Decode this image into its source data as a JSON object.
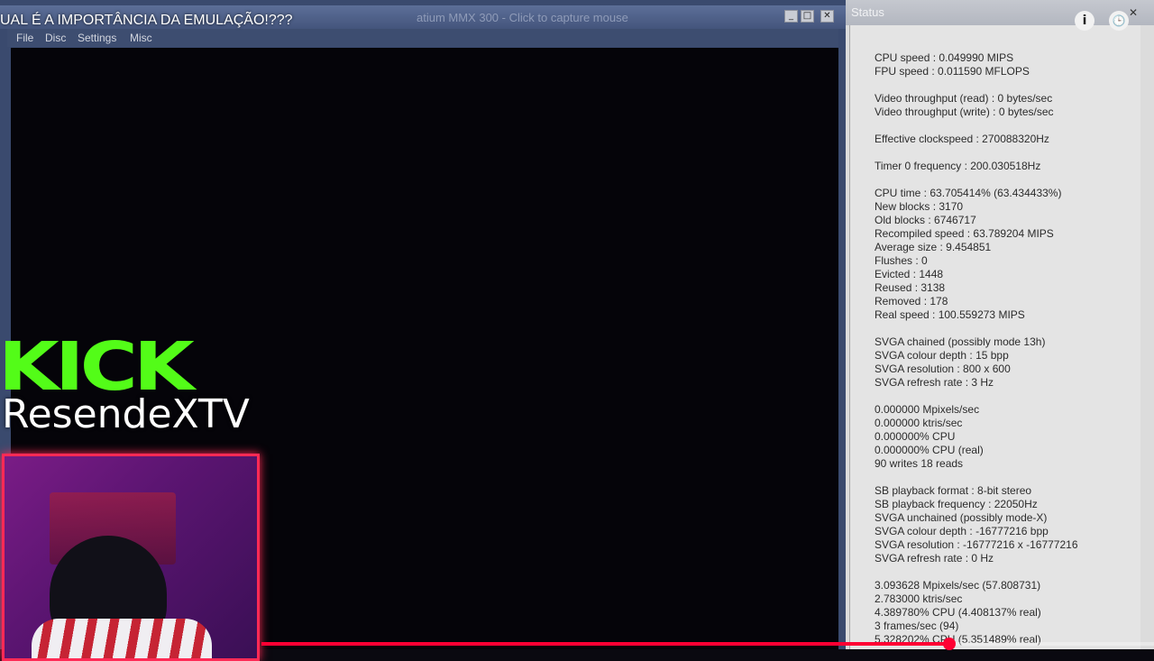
{
  "video": {
    "title": "UAL É A IMPORTÂNCIA DA EMULAÇÃO!???",
    "info_icon": "i",
    "clock_icon": "🕒",
    "progress": 0.771
  },
  "emulator": {
    "title": "atium MMX 300 - Click to capture mouse",
    "minimize": "_",
    "maximize": "□",
    "close": "✕",
    "menu": [
      "File",
      "Disc",
      "Settings",
      "Misc"
    ]
  },
  "status": {
    "title": "Status",
    "close": "✕",
    "lines": [
      "CPU speed : 0.049990 MIPS",
      "FPU speed : 0.011590 MFLOPS",
      "",
      "Video throughput (read) : 0 bytes/sec",
      "Video throughput (write) : 0 bytes/sec",
      "",
      "Effective clockspeed : 270088320Hz",
      "",
      "Timer 0 frequency : 200.030518Hz",
      "",
      "CPU time : 63.705414% (63.434433%)",
      "New blocks : 3170",
      "Old blocks : 6746717",
      "Recompiled speed : 63.789204 MIPS",
      "Average size : 9.454851",
      "Flushes : 0",
      "Evicted : 1448",
      "Reused : 3138",
      "Removed : 178",
      "Real speed : 100.559273 MIPS",
      "",
      "SVGA chained (possibly mode 13h)",
      "SVGA colour depth : 15 bpp",
      "SVGA resolution : 800 x 600",
      "SVGA refresh rate : 3 Hz",
      "",
      "0.000000 Mpixels/sec",
      "0.000000 ktris/sec",
      "0.000000% CPU",
      "0.000000% CPU (real)",
      "90 writes 18 reads",
      "",
      "SB playback format : 8-bit stereo",
      "SB playback frequency : 22050Hz",
      "SVGA unchained (possibly mode-X)",
      "SVGA colour depth : -16777216 bpp",
      "SVGA resolution : -16777216 x -16777216",
      "SVGA refresh rate : 0 Hz",
      "",
      "3.093628 Mpixels/sec (57.808731)",
      "2.783000 ktris/sec",
      "4.389780% CPU (4.408137% real)",
      "3 frames/sec (94)",
      "5.328202% CPU (5.351489% real)"
    ]
  },
  "overlay": {
    "logo": "KICK",
    "channel": "ResendeXTV"
  },
  "colors": {
    "kick_green": "#53fc18",
    "progress_red": "#ff0033",
    "webcam_border": "#ff2a55"
  }
}
